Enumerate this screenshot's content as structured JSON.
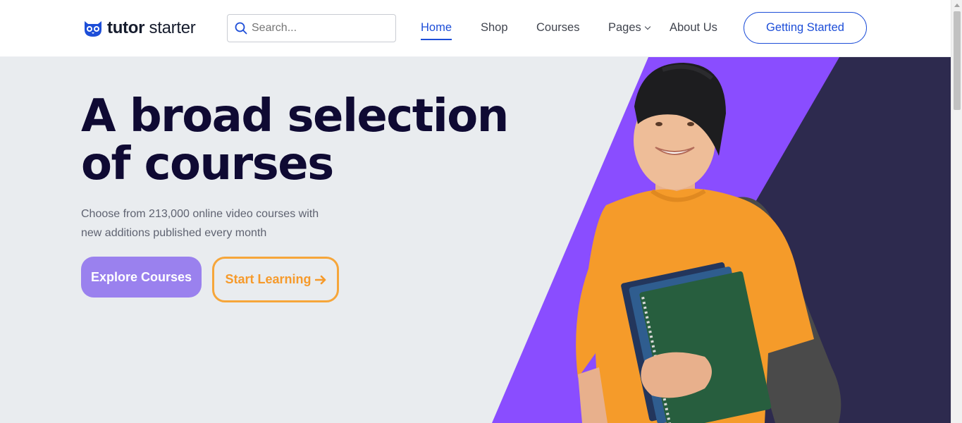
{
  "brand": {
    "name_bold": "tutor",
    "name_light": " starter"
  },
  "search": {
    "placeholder": "Search..."
  },
  "nav": {
    "items": [
      {
        "label": "Home",
        "active": true
      },
      {
        "label": "Shop"
      },
      {
        "label": "Courses"
      },
      {
        "label": "Pages",
        "has_dropdown": true
      },
      {
        "label": "About Us"
      }
    ],
    "cta_label": "Getting Started"
  },
  "hero": {
    "headline_line1": "A broad selection",
    "headline_line2": "of courses",
    "subtext_line1": "Choose from 213,000 online video courses with",
    "subtext_line2": "new additions published every month",
    "primary_button": "Explore Courses",
    "secondary_button": "Start Learning",
    "image_icon": "student-with-books-photo"
  },
  "colors": {
    "accent_blue": "#1d4ed8",
    "hero_bg": "#e9ecef",
    "purple_band": "#8a4dff",
    "dark_band": "#2d2a4e",
    "headline": "#0f0a33",
    "explore_button": "#9a81ee",
    "start_learning_orange": "#f6a63a"
  }
}
